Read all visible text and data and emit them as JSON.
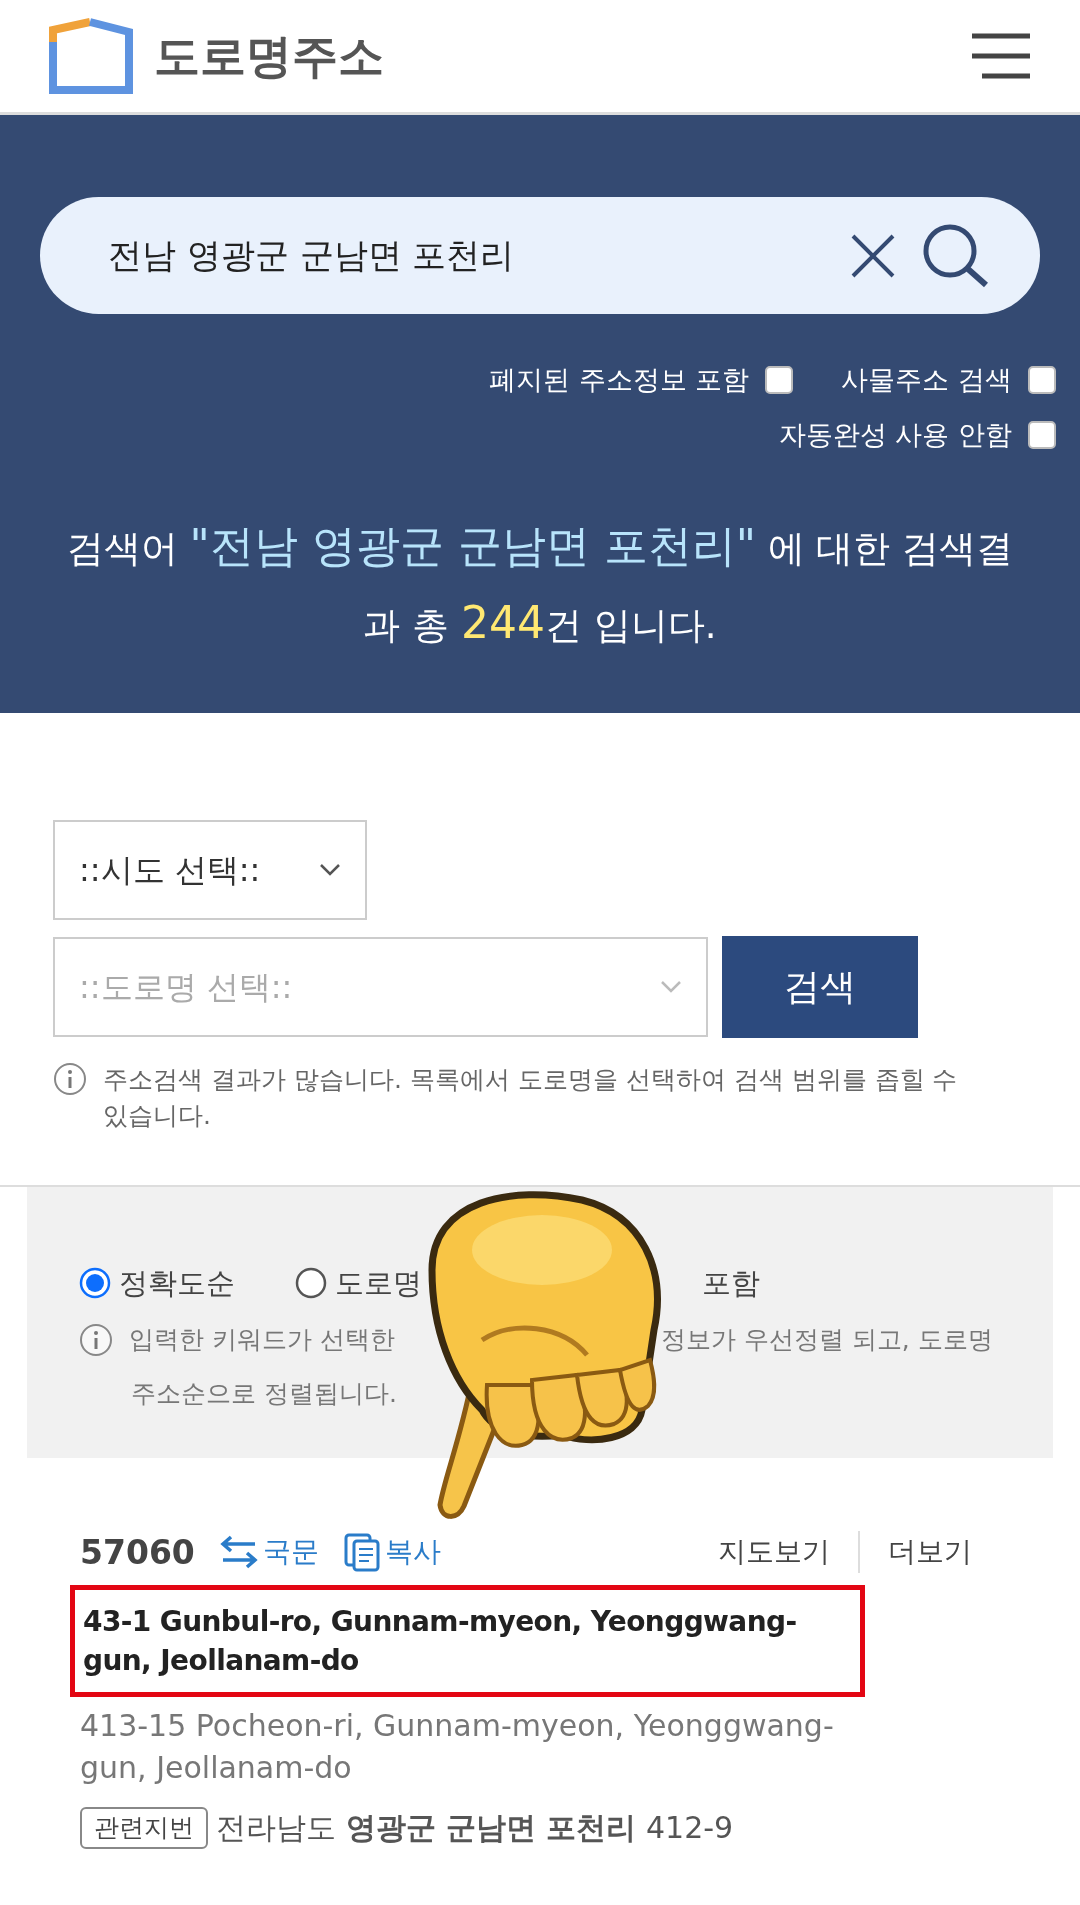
{
  "header": {
    "title": "도로명주소"
  },
  "search": {
    "value": "전남 영광군 군남면 포천리"
  },
  "options": [
    {
      "label": "폐지된 주소정보 포함",
      "checked": false
    },
    {
      "label": "사물주소 검색",
      "checked": false
    },
    {
      "label": "자동완성 사용 안함",
      "checked": false
    }
  ],
  "summary": {
    "prefix": "검색어",
    "query": "\"전남 영광군 군남면 포천리\"",
    "middle": "에 대한 검색결과 총",
    "count": "244",
    "suffix": "건 입니다."
  },
  "filters": {
    "sido_select": {
      "value": "::시도 선택::"
    },
    "road_select": {
      "placeholder": "::도로명 선택::"
    },
    "button": "검색",
    "notice": "주소검색 결과가 많습니다. 목록에서 도로명을 선택하여 검색 범위를 좁힐 수 있습니다."
  },
  "sort": {
    "options": [
      {
        "label": "정확도순",
        "selected": true
      },
      {
        "label": "도로명",
        "selected": false
      }
    ],
    "trailing_text": "포함",
    "info_lines": [
      [
        "입력한 키워드가 선택한",
        "정보가 우선정렬 되고, 도로명"
      ],
      [
        "주소순으로 정렬됩니다."
      ]
    ]
  },
  "result": {
    "zipcode": "57060",
    "actions": [
      {
        "kind": "swap",
        "label": "국문"
      },
      {
        "kind": "copy",
        "label": "복사"
      }
    ],
    "links": [
      "지도보기",
      "더보기"
    ],
    "road_address": "43-1 Gunbul-ro, Gunnam-myeon, Yeonggwang-gun, Jeollanam-do",
    "highlighted": true,
    "jibun_address": "413-15 Pocheon-ri, Gunnam-myeon, Yeonggwang-gun, Jeollanam-do",
    "related": {
      "tag": "관련지번",
      "text": "전라남도 **영광군 군남면 포천리** 412-9"
    }
  }
}
